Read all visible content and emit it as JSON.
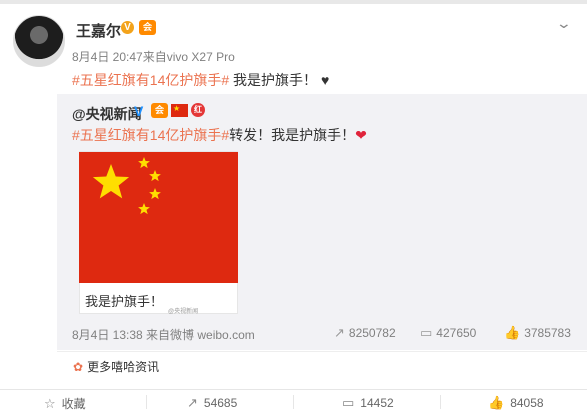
{
  "post": {
    "author": "王嘉尔",
    "verified_badge": "V",
    "vip_badge": "会",
    "meta": "8月4日 20:47来自vivo X27 Pro",
    "hashtag": "#五星红旗有14亿护旗手#",
    "text": " 我是护旗手！",
    "heart": "♥"
  },
  "repost": {
    "author": "@央视新闻",
    "verified_badge": "V",
    "vip_badge": "会",
    "badge_text": "红",
    "hashtag": "#五星红旗有14亿护旗手#",
    "text": "转发！我是护旗手！",
    "heart": "❤",
    "card_caption": "我是护旗手！",
    "watermark": "@央视新闻",
    "meta": "8月4日 13:38 来自微博 weibo.com",
    "stats": {
      "forwards": "8250782",
      "comments": "427650",
      "likes": "3785783"
    }
  },
  "more": {
    "label": "更多嘻哈资讯"
  },
  "actions": {
    "favorite": "收藏",
    "forward": "54685",
    "comment": "14452",
    "like": "84058"
  },
  "colors": {
    "accent": "#eb7350",
    "flag_red": "#de2910",
    "flag_yellow": "#ffde00"
  },
  "icons": {
    "chevron": "chevron-down-icon",
    "star": "star-icon",
    "forward": "forward-icon",
    "comment": "comment-icon",
    "like": "like-icon",
    "more": "flower-icon"
  }
}
